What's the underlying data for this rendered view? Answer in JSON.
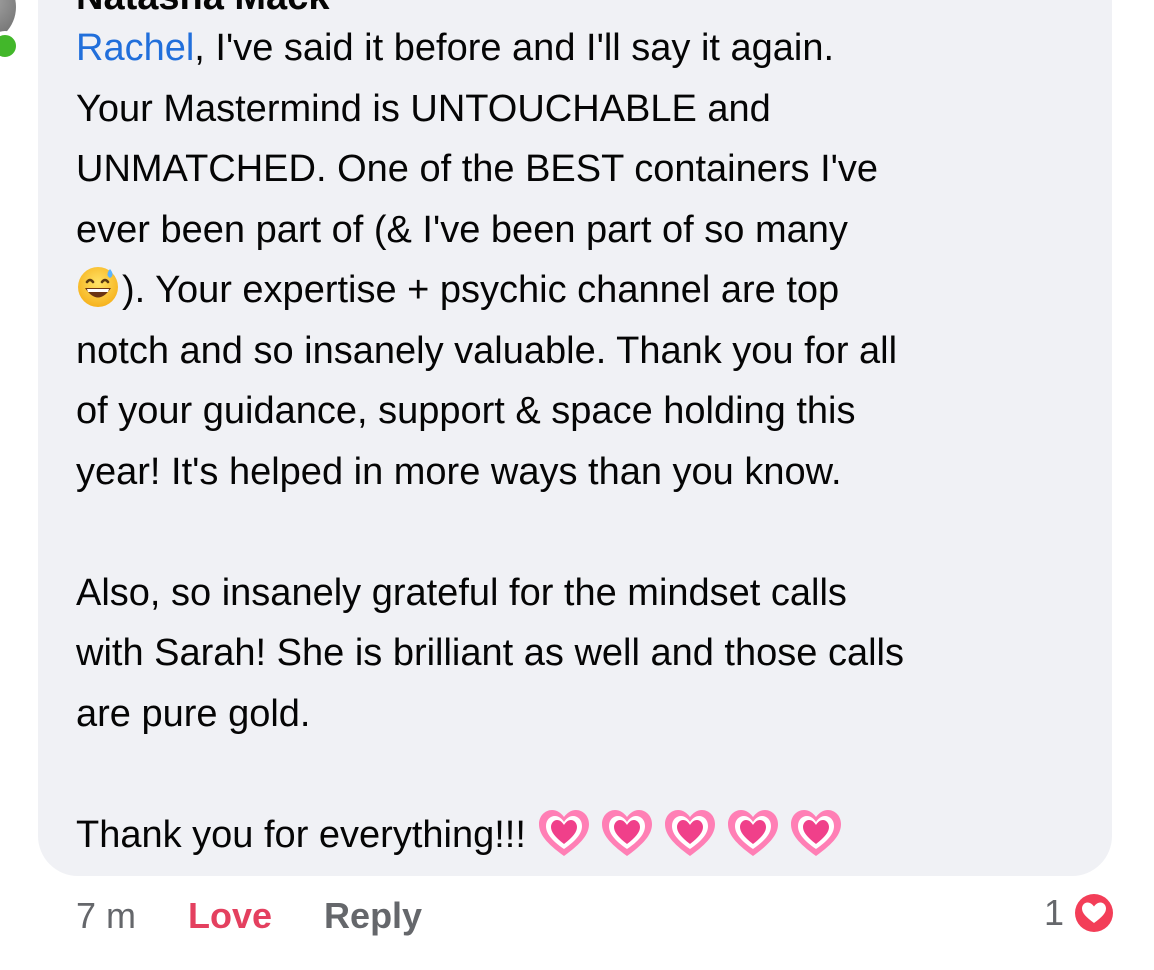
{
  "comment": {
    "author": "Natasha Mack",
    "mention": "Rachel",
    "lines": [
      ", I've said it before and I'll say it again.",
      "Your Mastermind is UNTOUCHABLE and",
      "UNMATCHED. One of the BEST containers I've",
      "ever been part of (& I've been part of so many",
      "). Your expertise + psychic channel are top",
      "notch and so insanely valuable. Thank you for all",
      "of your guidance, support & space holding this",
      "year! It's helped in more ways than you know.",
      "Also, so insanely grateful for the mindset calls",
      "with Sarah! She is brilliant as well and those calls",
      "are pure gold.",
      "Thank you for everything!!!"
    ],
    "emoji_inline": "grinning-sweat-emoji",
    "trailing_emojis": [
      "growing-heart-emoji",
      "growing-heart-emoji",
      "growing-heart-emoji",
      "growing-heart-emoji",
      "growing-heart-emoji"
    ]
  },
  "actions": {
    "timestamp": "7 m",
    "love_label": "Love",
    "reply_label": "Reply"
  },
  "reactions": {
    "count": "1",
    "icon": "love-reaction-icon"
  },
  "colors": {
    "bubble_bg": "#f0f1f5",
    "mention": "#216fdb",
    "love": "#e4405f",
    "meta": "#65676b",
    "online": "#42b72a"
  }
}
